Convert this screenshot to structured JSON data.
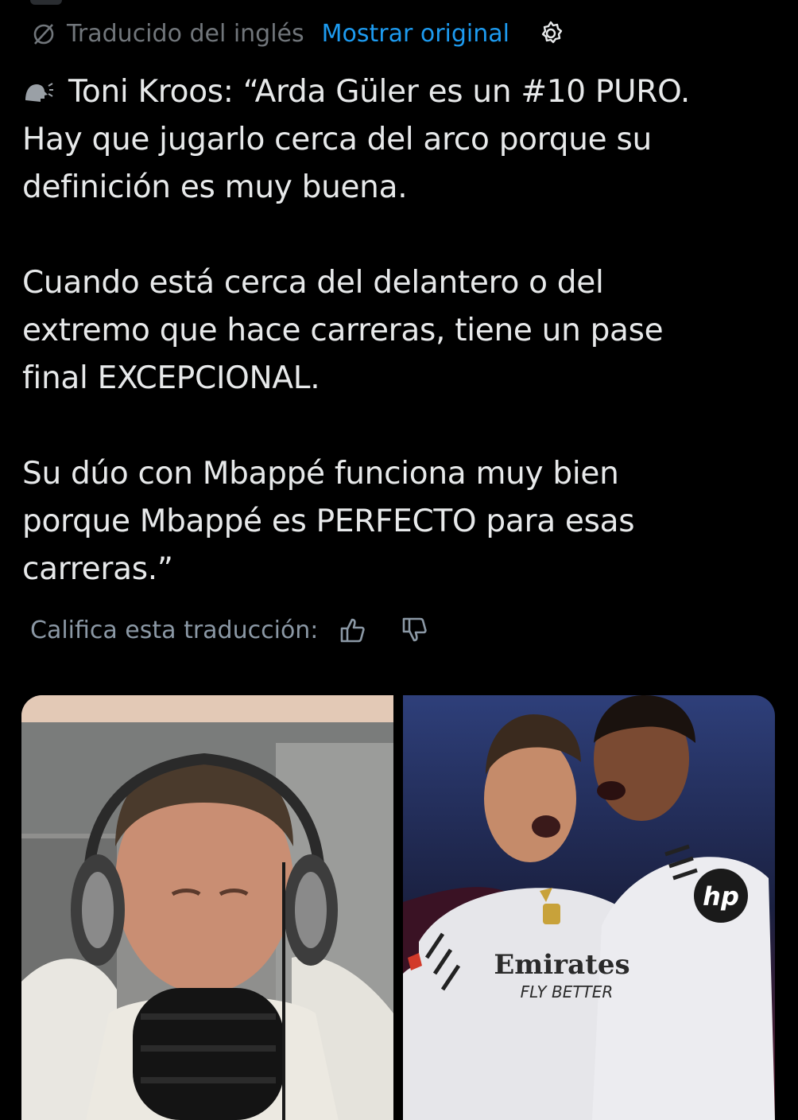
{
  "translation": {
    "label": "Traducido del inglés",
    "show_original": "Mostrar original"
  },
  "tweet": {
    "paragraphs": [
      "Toni Kroos: “Arda Güler es un #10 PURO.\nHay que jugarlo cerca del arco porque su\ndefinición es muy buena.",
      "Cuando está cerca del delantero o del\nextremo que hace carreras, tiene un pase\nfinal EXCEPCIONAL.",
      "Su dúo con Mbappé funciona muy bien\nporque Mbappé es PERFECTO para esas\ncarreras.”"
    ]
  },
  "rating": {
    "label": "Califica esta traducción:"
  },
  "media": {
    "images": [
      {
        "name": "toni-kroos-podcast-photo"
      },
      {
        "name": "guler-mbappe-celebration-photo",
        "sponsor_text": "Emirates",
        "sponsor_tagline": "FLY BETTER",
        "sleeve_logo": "hp"
      }
    ]
  },
  "colors": {
    "background": "#000000",
    "text": "#e7e9ea",
    "muted": "#71767b",
    "link": "#1d9bf0"
  }
}
